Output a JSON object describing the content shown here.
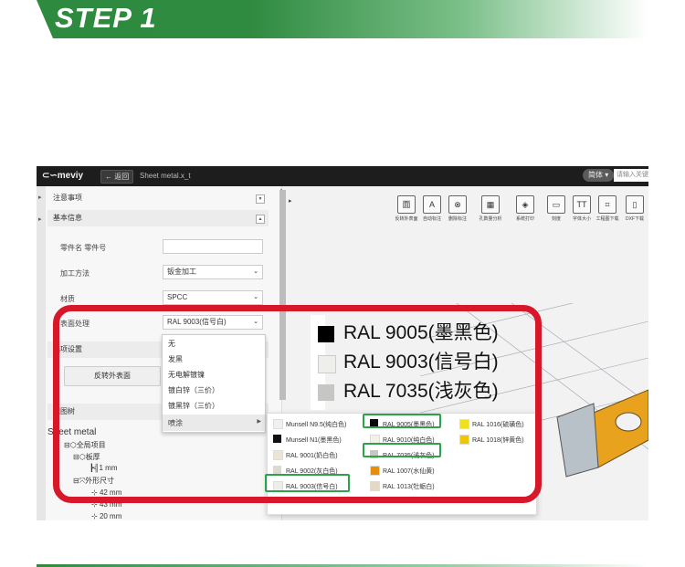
{
  "banner": {
    "title": "STEP 1"
  },
  "app": {
    "logo": "meviy",
    "back_label": "返回",
    "file_name": "Sheet metal.x_t",
    "lang_label": "简体",
    "search_placeholder": "请输入关键"
  },
  "panel": {
    "notes_title": "注意事项",
    "basic_title": "基本信息",
    "rows": [
      {
        "label": "零件名 零件号",
        "value": ""
      },
      {
        "label": "加工方法",
        "value": "钣金加工"
      },
      {
        "label": "材质",
        "value": "SPCC"
      },
      {
        "label": "表面处理",
        "value": "RAL 9003(信号白)"
      }
    ],
    "options_title": "选项设置",
    "reverse_button": "反转外表面",
    "view_tree_title": "视图树",
    "tree": {
      "root": "Sheet metal",
      "all_items": "全局项目",
      "thickness": "板厚",
      "thickness_value": "1 mm",
      "outer_dims": "外形尺寸",
      "dims": [
        "42 mm",
        "43 mm",
        "20 mm"
      ]
    }
  },
  "dropdown": {
    "items": [
      "无",
      "发黑",
      "无电解镀镍",
      "镀白锌（三价）",
      "镀黑锌（三价）",
      "喷涂"
    ]
  },
  "toolbar": {
    "tools": [
      {
        "icon": "face-icon",
        "glyph": "面",
        "label": "反转外表面"
      },
      {
        "icon": "dimension-icon",
        "glyph": "A",
        "label": "自动标注"
      },
      {
        "icon": "clear-icon",
        "glyph": "⊗",
        "label": "删除标注"
      },
      {
        "icon": "hole-icon",
        "glyph": "▦",
        "label": "孔数量分析"
      },
      {
        "icon": "stamp-icon",
        "glyph": "◈",
        "label": "系统打印"
      },
      {
        "icon": "sheet-icon",
        "glyph": "▭",
        "label": "刻度"
      },
      {
        "icon": "text-icon",
        "glyph": "TT",
        "label": "字体大小"
      },
      {
        "icon": "drawing-icon",
        "glyph": "⌗",
        "label": "工程图下载"
      },
      {
        "icon": "dxf-icon",
        "glyph": "▯",
        "label": "DXF下载"
      }
    ]
  },
  "colors": {
    "col1": [
      {
        "label": "Munsell N9.5(纯白色)",
        "color": "#eef0f3"
      },
      {
        "label": "Munsell N1(墨黑色)",
        "color": "#111111"
      },
      {
        "label": "RAL 9001(奶白色)",
        "color": "#ece4d4"
      },
      {
        "label": "RAL 9002(灰白色)",
        "color": "#dcdad0"
      },
      {
        "label": "RAL 9003(信号白)",
        "color": "#eceeea"
      }
    ],
    "col2": [
      {
        "label": "RAL 9005(墨黑色)",
        "color": "#0a0a0a"
      },
      {
        "label": "RAL 9010(纯白色)",
        "color": "#f3f0e6"
      },
      {
        "label": "RAL 7035(浅灰色)",
        "color": "#c5c7c4"
      },
      {
        "label": "RAL 1007(水仙黄)",
        "color": "#e78f0b"
      },
      {
        "label": "RAL 1013(牡蛎白)",
        "color": "#e3d9c6"
      }
    ],
    "col3": [
      {
        "label": "RAL 1016(硫磺色)",
        "color": "#f1e11d"
      },
      {
        "label": "RAL 1018(锌黄色)",
        "color": "#f1c600"
      }
    ]
  },
  "legend": [
    {
      "label": "RAL 9005(墨黑色)",
      "color": "#000000"
    },
    {
      "label": "RAL 9003(信号白)",
      "color": "#eeeeea"
    },
    {
      "label": "RAL 7035(浅灰色)",
      "color": "#c6c7c4"
    }
  ],
  "accent": {
    "red": "#d7182a",
    "green": "#2ca34a",
    "brand": "#2e8a3e"
  }
}
